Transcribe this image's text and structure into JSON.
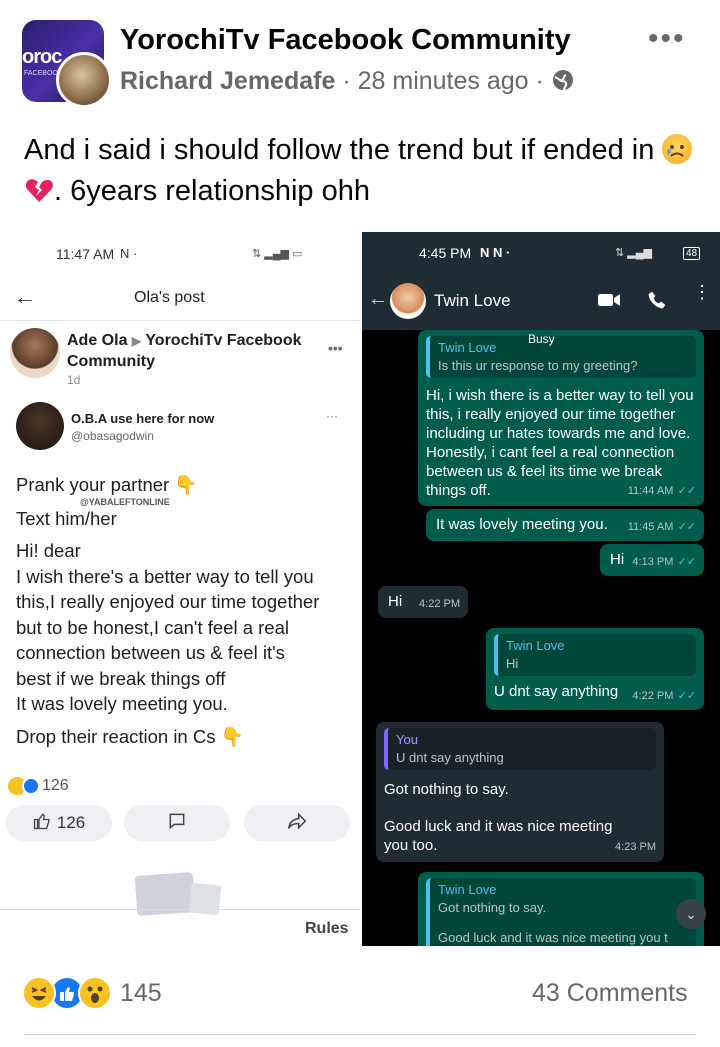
{
  "post": {
    "group_name": "YorochiTv Facebook Community",
    "author": "Richard Jemedafe",
    "time": "28 minutes ago",
    "separator": "·",
    "caption_part1": "And i said i should follow the trend but if ended in",
    "caption_part2": ". 6years relationship ohh",
    "reactions_count": "145",
    "comments_count": "43 Comments",
    "avatar_logo_text": "oroc",
    "avatar_sub_text": "FACEBOOK"
  },
  "left_screenshot": {
    "status_time": "11:47 AM",
    "title": "Ola's post",
    "poster": "Ade Ola",
    "poster_group": "YorochiTv Facebook",
    "poster_group2": "Community",
    "poster_time": "1d",
    "quoted_name": "O.B.A use here for now",
    "quoted_handle": "@obasagodwin",
    "watermark": "@YABALEFTONLINE",
    "lines": [
      "Prank your partner 👇",
      "Text him/her",
      "Hi! dear",
      "I wish there's a better way to tell you",
      "this,I really enjoyed our time together",
      "but to be honest,I can't feel a real",
      "connection between us & feel it's",
      "best if we break things off",
      " It was lovely meeting you.",
      "Drop their reaction in Cs 👇"
    ],
    "reaction_count": "126",
    "like_count": "126",
    "rules_label": "Rules"
  },
  "right_screenshot": {
    "status_time": "4:45 PM",
    "status_battery": "48",
    "contact_name": "Twin Love",
    "messages": {
      "m1_status": "Busy",
      "m1_quote_name": "Twin Love",
      "m1_quote_text": "Is this ur response to my greeting?",
      "m1_text": "Hi, i wish there is a better way to tell you this, i really enjoyed our time together including ur hates towards me and love. Honestly,  i cant feel a real connection between us & feel its time we break things off.",
      "m1_time": "11:44 AM",
      "m2_text": "It was lovely meeting you.",
      "m2_time": "11:45 AM",
      "m3_text": "Hi",
      "m3_time": "4:13 PM",
      "m4_text": "Hi",
      "m4_time": "4:22 PM",
      "m5_quote_name": "Twin Love",
      "m5_quote_text": "Hi",
      "m5_text": "U dnt say anything",
      "m5_time": "4:22 PM",
      "m6_quote_name": "You",
      "m6_quote_text": "U dnt say anything",
      "m6_text1": "Got nothing to say.",
      "m6_text2": "Good luck and it was nice meeting you too.",
      "m6_time": "4:23 PM",
      "m7_quote_name": "Twin Love",
      "m7_quote_text": "Got nothing to say.",
      "m7_quote_text2": "Good luck and it was nice meeting you t"
    }
  },
  "colors": {
    "wa_out": "#005c4b",
    "wa_in": "#202c33",
    "wa_header": "#202c33",
    "fb_gray": "#65676b",
    "like_blue": "#1877f2"
  },
  "icons": [
    "globe-icon",
    "more-icon",
    "back-arrow-icon",
    "video-call-icon",
    "phone-icon",
    "like-icon",
    "comment-icon",
    "share-icon",
    "haha-reaction-icon",
    "like-reaction-icon",
    "wow-reaction-icon",
    "sad-emoji-icon",
    "broken-heart-icon",
    "scroll-down-icon"
  ]
}
